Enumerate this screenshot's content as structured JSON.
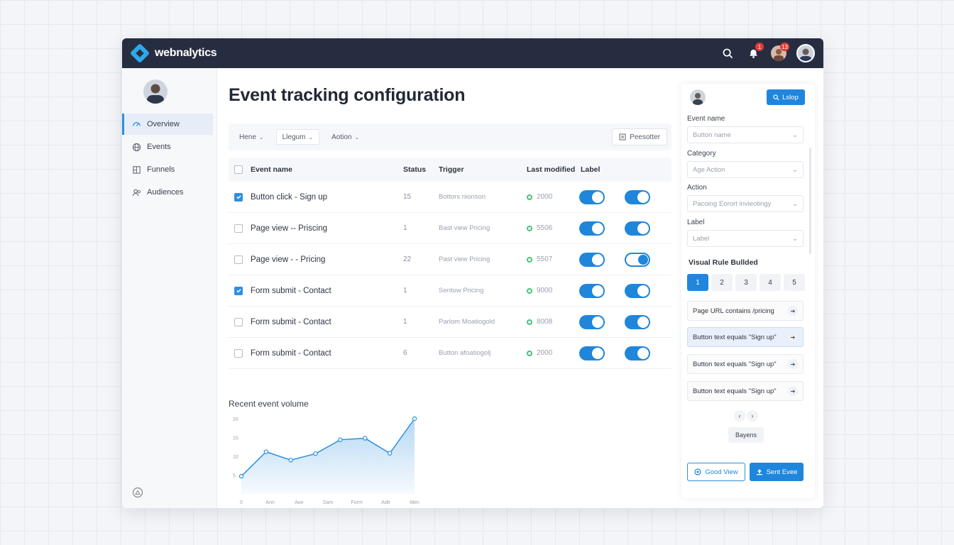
{
  "app": {
    "brand": "webnalytics",
    "notif_badge": "1",
    "avatar_badge": "13"
  },
  "sidebar": {
    "items": [
      {
        "label": "Overview",
        "icon": "overview-icon",
        "active": true
      },
      {
        "label": "Events",
        "icon": "events-icon",
        "active": false
      },
      {
        "label": "Funnels",
        "icon": "funnels-icon",
        "active": false
      },
      {
        "label": "Audiences",
        "icon": "audiences-icon",
        "active": false
      }
    ]
  },
  "main": {
    "title": "Event tracking configuration",
    "filters": [
      "Hene",
      "Llegum",
      "Aotion"
    ],
    "preset_button": "Peesotter",
    "table": {
      "headers": {
        "name": "Event name",
        "status": "Status",
        "trigger": "Trigger",
        "modified": "Last modified",
        "label": "Label"
      },
      "rows": [
        {
          "checked": true,
          "name": "Button click - Sign up",
          "status": "15",
          "trigger": "Bottors nionson",
          "modified": "2000",
          "toggle1": "on",
          "toggle2": "on"
        },
        {
          "checked": false,
          "name": "Page view -- Priscing",
          "status": "1",
          "trigger": "Bast view Pricing",
          "modified": "5506",
          "toggle1": "on",
          "toggle2": "on"
        },
        {
          "checked": false,
          "name": "Page view - - Pricing",
          "status": "22",
          "trigger": "Past view Pricing",
          "modified": "5507",
          "toggle1": "on",
          "toggle2": "outline"
        },
        {
          "checked": true,
          "name": "Form submit - Contact",
          "status": "1",
          "trigger": "Sentow Pricing",
          "modified": "9000",
          "toggle1": "on",
          "toggle2": "on"
        },
        {
          "checked": false,
          "name": "Form submit - Contact",
          "status": "1",
          "trigger": "Parlom Moatiogold",
          "modified": "8008",
          "toggle1": "on",
          "toggle2": "on"
        },
        {
          "checked": false,
          "name": "Form submit - Contact",
          "status": "6",
          "trigger": "Button afoatiogolj",
          "modified": "2000",
          "toggle1": "on",
          "toggle2": "on"
        }
      ]
    },
    "chart_title": "Recent event volume"
  },
  "chart_data": {
    "type": "area",
    "x": [
      "0",
      "Ann",
      "Aon",
      "Sam",
      "Form",
      "Adit",
      "Men"
    ],
    "categories": [
      "0",
      "Ann",
      "Aon",
      "Sam",
      "Form",
      "Adit",
      "Men"
    ],
    "y_ticks": [
      "20",
      "15",
      "10",
      "5"
    ],
    "ylim": [
      0,
      20
    ],
    "points": [
      [
        0,
        4.7
      ],
      [
        1,
        11.2
      ],
      [
        2,
        9.0
      ],
      [
        3,
        10.7
      ],
      [
        4,
        14.4
      ],
      [
        5,
        14.8
      ],
      [
        6,
        10.8
      ],
      [
        7,
        20.0
      ]
    ],
    "color": "#2d8fe0"
  },
  "panel": {
    "top_button": "Lslop",
    "fields": [
      {
        "label": "Event name",
        "placeholder": "Button name"
      },
      {
        "label": "Category",
        "placeholder": "Age Action"
      },
      {
        "label": "Action",
        "placeholder": "Pacoing Eorort invieotingy"
      },
      {
        "label": "Label",
        "placeholder": "Label"
      }
    ],
    "visual_title": "Visual Rule Bullded",
    "steps": [
      "1",
      "2",
      "3",
      "4",
      "5"
    ],
    "rules": [
      "Page URL contains /pricing",
      "Button text equals \"Sign up\"",
      "Button text equals \"Sign up\"",
      "Button text equals \"Sign up\""
    ],
    "small_button": "Bayens",
    "outline_button": "Good View",
    "solid_button": "Sent Evee"
  },
  "colors": {
    "accent": "#1f86dc",
    "topbar": "#272d40",
    "success": "#46c27a"
  }
}
